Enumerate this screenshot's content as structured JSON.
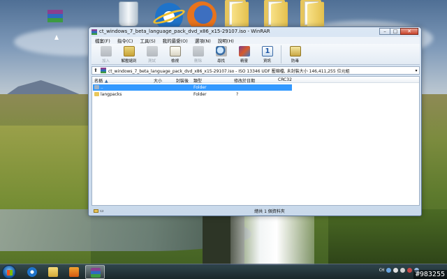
{
  "window": {
    "title": "ct_windows_7_beta_language_pack_dvd_x86_x15-29107.iso - WinRAR"
  },
  "menubar": {
    "items": [
      "檔案(F)",
      "指令(C)",
      "工具(S)",
      "我的最愛(O)",
      "選項(N)",
      "說明(H)"
    ]
  },
  "toolbar": {
    "buttons": [
      {
        "label": "加入",
        "icon": "add-icon",
        "enabled": false
      },
      {
        "label": "解壓縮到",
        "icon": "extract-icon",
        "enabled": true
      },
      {
        "label": "測試",
        "icon": "test-icon",
        "enabled": false
      },
      {
        "label": "檢視",
        "icon": "view-icon",
        "enabled": true
      },
      {
        "label": "刪除",
        "icon": "delete-icon",
        "enabled": false
      },
      {
        "label": "尋找",
        "icon": "find-icon",
        "enabled": true
      },
      {
        "label": "精靈",
        "icon": "wizard-icon",
        "enabled": true
      },
      {
        "label": "資訊",
        "icon": "info-icon",
        "enabled": true
      },
      {
        "label": "防毒",
        "icon": "virus-scan-icon",
        "enabled": true
      }
    ]
  },
  "address": {
    "text": "ct_windows_7_beta_language_pack_dvd_x86_x15-29107.iso - ISO 13346 UDF 壓縮檔, 未封裝大小 146,411,255 位元組"
  },
  "columns": {
    "name": "名稱",
    "size": "大小",
    "packed": "封裝後",
    "type": "類型",
    "modified": "修改於日期",
    "crc": "CRC32"
  },
  "files": [
    {
      "name": "..",
      "type": "Folder",
      "modified": "",
      "selected": true
    },
    {
      "name": "langpacks",
      "type": "Folder",
      "modified": "?",
      "selected": false
    }
  ],
  "status": {
    "text": "總共 1 個資料夾"
  },
  "taskbar": {
    "lang": "CH",
    "watermark": "#983255"
  },
  "colors": {
    "selection": "#3399ff",
    "window_frame": "#c9d9eb"
  }
}
